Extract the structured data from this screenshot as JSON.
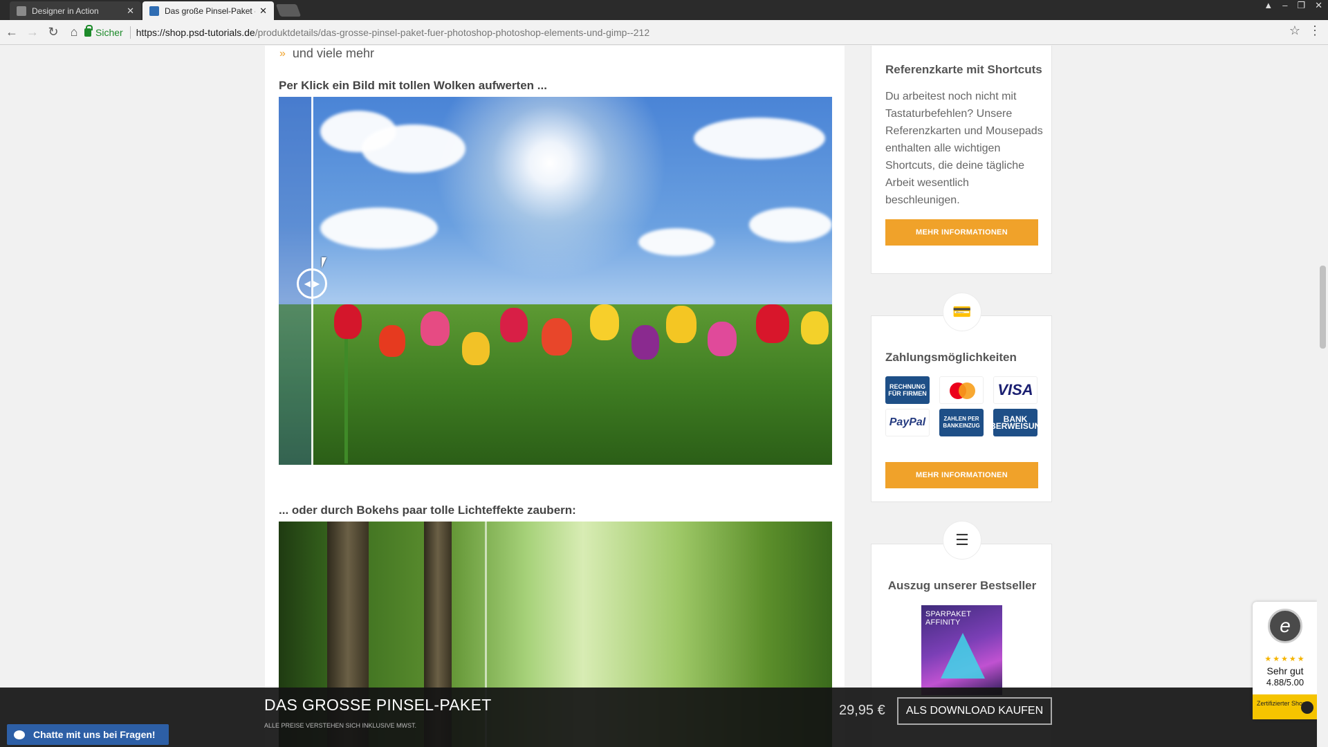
{
  "browser": {
    "tabs": [
      {
        "title": "Designer in Action",
        "active": false
      },
      {
        "title": "Das große Pinsel-Paket - ",
        "active": true
      }
    ],
    "secure_label": "Sicher",
    "url_host": "https://shop.psd-tutorials.de",
    "url_path": "/produktdetails/das-grosse-pinsel-paket-fuer-photoshop-photoshop-elements-und-gimp--212"
  },
  "content": {
    "list_item": "und viele mehr",
    "heading_clouds": "Per Klick ein Bild mit tollen Wolken aufwerten ...",
    "heading_bokeh": "... oder durch Bokehs paar tolle Lichteffekte zaubern:"
  },
  "sidebar": {
    "shortcuts": {
      "title": "Referenzkarte mit Shortcuts",
      "text": "Du arbeitest noch nicht mit Tastaturbefehlen? Unsere Referenzkarten und Mousepads enthalten alle wichtigen Shortcuts, die deine tägliche Arbeit wesentlich beschleunigen.",
      "button": "MEHR INFORMATIONEN"
    },
    "payment": {
      "title": "Zahlungsmöglichkeiten",
      "methods": [
        "RECHNUNG FÜR FIRMEN",
        "mastercard",
        "VISA",
        "PayPal",
        "ZAHLEN PER BANKEINZUG",
        "BANK ÜBERWEISUNG"
      ],
      "button": "MEHR INFORMATIONEN"
    },
    "bestseller": {
      "title": "Auszug unserer Bestseller",
      "product_tag": "SPARPAKET AFFINITY"
    }
  },
  "buybar": {
    "title": "DAS GROSSE PINSEL-PAKET",
    "note": "ALLE PREISE VERSTEHEN SICH INKLUSIVE MWST.",
    "price": "29,95 €",
    "button": "ALS DOWNLOAD KAUFEN"
  },
  "chat": {
    "label": "Chatte mit uns bei Fragen!"
  },
  "trusted_shops": {
    "stars": "★★★★★",
    "rating_label": "Sehr gut",
    "score": "4.88/5.00",
    "cert": "Zertifizierter Shop"
  },
  "colors": {
    "accent_orange": "#f0a22a",
    "chat_blue": "#2d5fa6"
  }
}
